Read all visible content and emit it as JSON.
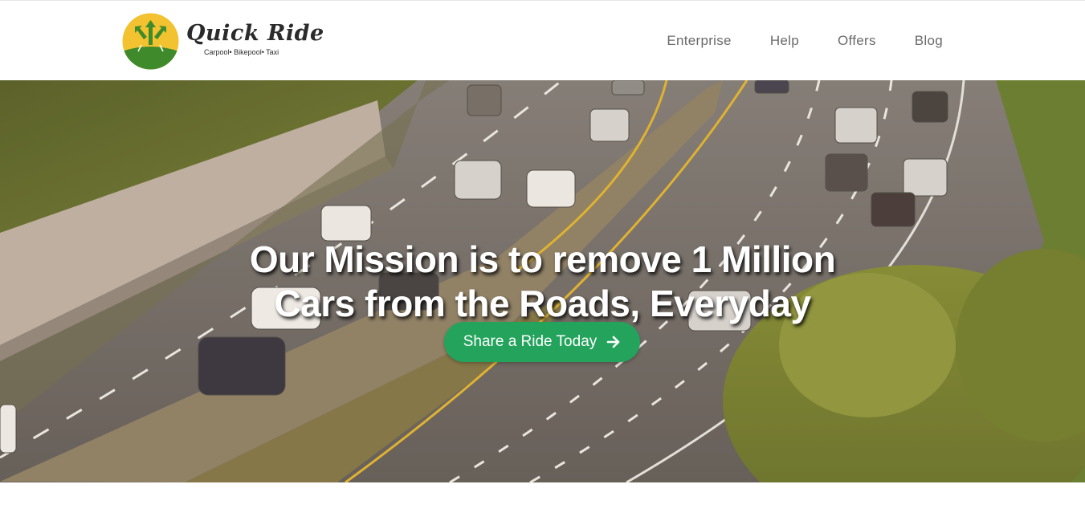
{
  "brand": {
    "name": "Quick Ride",
    "tagline": "Carpool• Bikepool• Taxi",
    "logo_colors": {
      "yellow": "#f2c230",
      "green": "#3f8a2a",
      "arrows": "#3f8a2a"
    }
  },
  "nav": {
    "items": [
      {
        "label": "Enterprise"
      },
      {
        "label": "Help"
      },
      {
        "label": "Offers"
      },
      {
        "label": "Blog"
      }
    ]
  },
  "hero": {
    "title_line1": "Our Mission is to remove 1 Million",
    "title_line2": "Cars from the Roads, Everyday",
    "cta_label": "Share a Ride Today",
    "cta_icon": "arrow-right-icon",
    "background": "highway-photo"
  },
  "colors": {
    "cta": "#23a35c",
    "nav_text": "#6a6a6a",
    "hero_text": "#ffffff"
  }
}
